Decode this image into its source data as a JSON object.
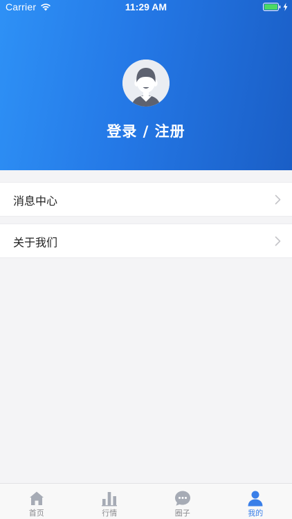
{
  "status_bar": {
    "carrier": "Carrier",
    "time": "11:29 AM",
    "icons": [
      "wifi-icon",
      "battery-icon",
      "charging-bolt-icon"
    ]
  },
  "profile": {
    "avatar_icon": "avatar-icon",
    "login_label": "登录 / 注册"
  },
  "menu": {
    "items": [
      {
        "label": "消息中心",
        "icon": "chevron-right-icon"
      },
      {
        "label": "关于我们",
        "icon": "chevron-right-icon"
      }
    ]
  },
  "tab_bar": {
    "tabs": [
      {
        "label": "首页",
        "icon": "home-icon",
        "active": false
      },
      {
        "label": "行情",
        "icon": "bar-chart-icon",
        "active": false
      },
      {
        "label": "圈子",
        "icon": "chat-bubble-icon",
        "active": false
      },
      {
        "label": "我的",
        "icon": "user-icon",
        "active": true
      }
    ]
  },
  "colors": {
    "header_gradient_start": "#2e91f6",
    "header_gradient_end": "#1a5ec6",
    "active_tab": "#3a7fe8",
    "inactive_tab": "#8a8a8e",
    "page_background": "#f4f4f6"
  }
}
